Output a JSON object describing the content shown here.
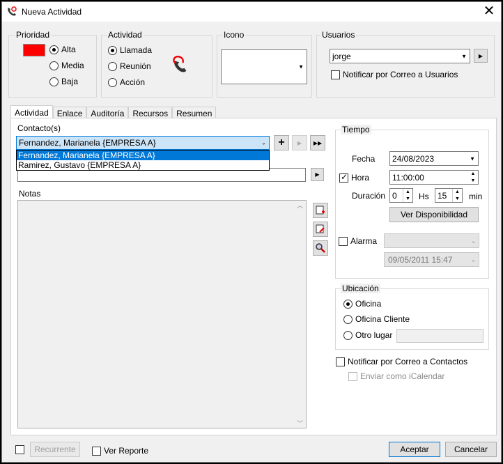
{
  "window": {
    "title": "Nueva Actividad"
  },
  "prioridad": {
    "title": "Prioridad",
    "color": "#ff0000",
    "options": [
      {
        "label": "Alta",
        "checked": true
      },
      {
        "label": "Media",
        "checked": false
      },
      {
        "label": "Baja",
        "checked": false
      }
    ]
  },
  "actividad": {
    "title": "Actividad",
    "options": [
      {
        "label": "Llamada",
        "checked": true
      },
      {
        "label": "Reunión",
        "checked": false
      },
      {
        "label": "Acción",
        "checked": false
      }
    ],
    "icon": "phone-call-icon"
  },
  "icono": {
    "title": "Icono",
    "value": ""
  },
  "usuarios": {
    "title": "Usuarios",
    "selected": "jorge",
    "notify_label": "Notificar por Correo a Usuarios"
  },
  "tabs": [
    "Actividad",
    "Enlace",
    "Auditoría",
    "Recursos",
    "Resumen"
  ],
  "contactos": {
    "label": "Contacto(s)",
    "selected": "Fernandez, Marianela {EMPRESA A}",
    "options": [
      "Fernandez, Marianela {EMPRESA A}",
      "Ramirez, Gustavo {EMPRESA A}"
    ]
  },
  "notas": {
    "label": "Notas"
  },
  "tiempo": {
    "title": "Tiempo",
    "fecha_label": "Fecha",
    "fecha": "24/08/2023",
    "hora_label": "Hora",
    "hora": "11:00:00",
    "duracion_label": "Duración",
    "hs_value": "0",
    "hs_label": "Hs",
    "min_value": "15",
    "min_label": "min",
    "ver_disponibilidad": "Ver Disponibilidad",
    "alarma_label": "Alarma",
    "alarma_datetime": "09/05/2011 15:47"
  },
  "ubicacion": {
    "title": "Ubicación",
    "options": [
      {
        "label": "Oficina",
        "checked": true
      },
      {
        "label": "Oficina Cliente",
        "checked": false
      },
      {
        "label": "Otro lugar",
        "checked": false
      }
    ]
  },
  "notificar_contactos": "Notificar por Correo a Contactos",
  "enviar_icalendar": "Enviar como iCalendar",
  "footer": {
    "recurrente": "Recurrente",
    "ver_reporte": "Ver Reporte",
    "aceptar": "Aceptar",
    "cancelar": "Cancelar"
  }
}
